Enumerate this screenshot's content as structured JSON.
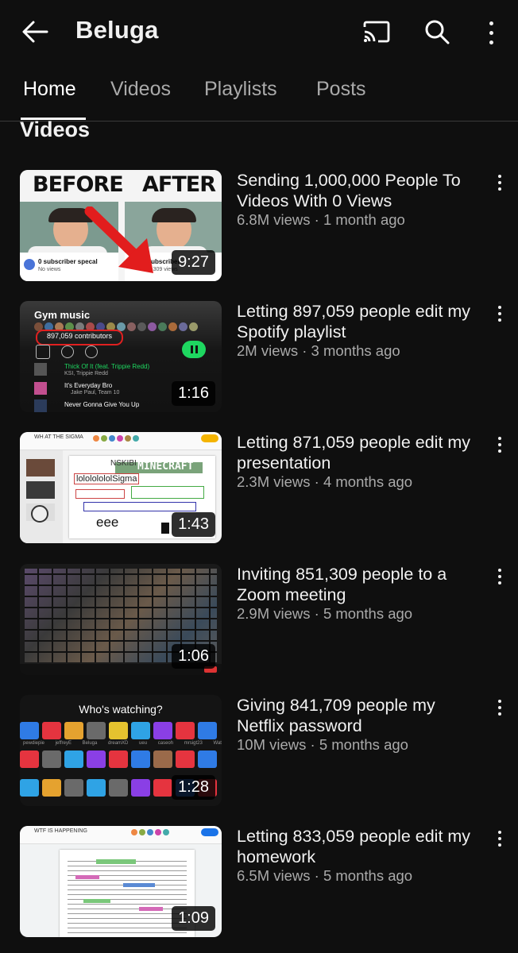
{
  "header": {
    "title": "Beluga",
    "icons": [
      "back-arrow-icon",
      "cast-icon",
      "search-icon",
      "more-vertical-icon"
    ]
  },
  "tabs": [
    {
      "label": "Home",
      "active": true
    },
    {
      "label": "Videos",
      "active": false
    },
    {
      "label": "Playlists",
      "active": false
    },
    {
      "label": "Posts",
      "active": false
    }
  ],
  "section": {
    "title": "Videos"
  },
  "videos": [
    {
      "title": "Sending 1,000,000 People To Videos With 0 Views",
      "meta": "6.8M views · 1 month ago",
      "duration": "9:27",
      "thumb_text": {
        "before": "BEFORE",
        "after": "AFTER",
        "left_caption": "0 subscriber specal",
        "left_sub": "No views",
        "right_caption": "0 subscriber",
        "right_sub": "971,309 views"
      }
    },
    {
      "title": "Letting 897,059 people edit my Spotify playlist",
      "meta": "2M views · 3 months ago",
      "duration": "1:16",
      "thumb_text": {
        "heading": "Gym music",
        "contributors": "897,059 contributors",
        "song1": "Thick Of It (feat. Trippie Redd)",
        "artist1": "KSI, Trippie Redd",
        "song2": "It's Everyday Bro",
        "artist2": "Jake Paul, Team 10",
        "song3": "Never Gonna Give You Up"
      }
    },
    {
      "title": "Letting 871,059 people edit my presentation",
      "meta": "2.3M views · 4 months ago",
      "duration": "1:43",
      "thumb_text": {
        "doc": "WH AT THE SIGMA",
        "word1": "NSKIBI",
        "word2": "MINECRAFT",
        "word3": "lolololololSigma",
        "word4": "eee"
      }
    },
    {
      "title": "Inviting 851,309 people to a Zoom meeting",
      "meta": "2.9M views · 5 months ago",
      "duration": "1:06"
    },
    {
      "title": "Giving 841,709 people my Netflix password",
      "meta": "10M views · 5 months ago",
      "duration": "1:28",
      "thumb_text": {
        "heading": "Who's watching?",
        "names": [
          "pewdiepie",
          "jeffreyE",
          "Beluga",
          "dreamXD",
          "ueu",
          "caseoh",
          "mrsigt23",
          "Wat"
        ]
      }
    },
    {
      "title": "Letting 833,059 people edit my homework",
      "meta": "6.5M views · 5 months ago",
      "duration": "1:09",
      "thumb_text": {
        "doc": "WTF IS HAPPENING"
      }
    }
  ],
  "colors": {
    "background": "#0f0f0f",
    "text": "#f1f1f1",
    "secondary": "#aaaaaa",
    "spotify_green": "#1ed760",
    "netflix_bg": "#141414"
  }
}
